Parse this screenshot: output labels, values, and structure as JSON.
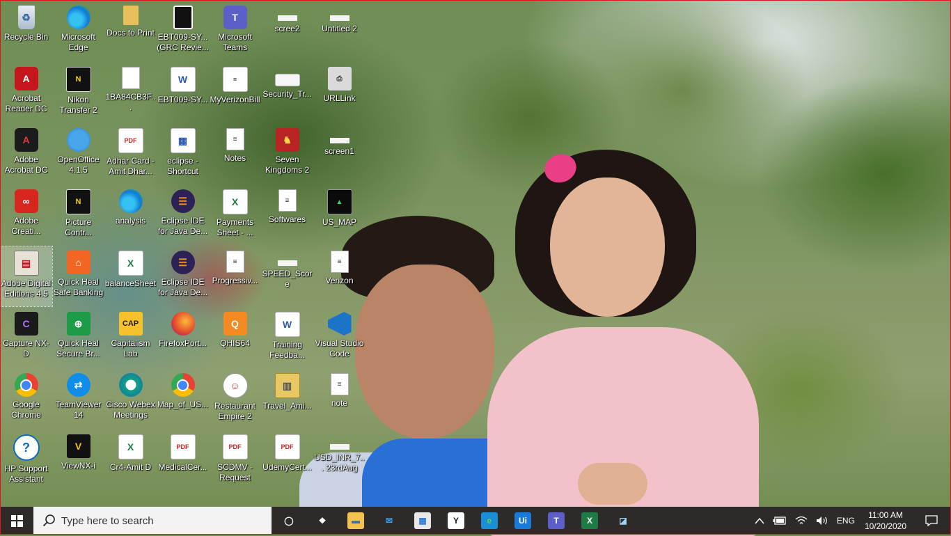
{
  "desktop": {
    "icons": [
      {
        "label": "Recycle Bin",
        "icon": "recycle-bin-icon",
        "glyph": "♻",
        "style": "ic-recycle",
        "col": 0,
        "row": 0
      },
      {
        "label": "Microsoft Edge",
        "icon": "edge-icon",
        "glyph": "",
        "style": "ic-edge",
        "col": 1,
        "row": 0
      },
      {
        "label": "Docs to Print",
        "icon": "folder-icon",
        "glyph": "",
        "style": "ic-folder",
        "col": 2,
        "row": 0
      },
      {
        "label": "EBT009-SY... (GRC Revie...",
        "icon": "document-icon",
        "glyph": "",
        "style": "ic-docblack",
        "col": 3,
        "row": 0
      },
      {
        "label": "Microsoft Teams",
        "icon": "teams-icon",
        "glyph": "T",
        "style": "ic-teams",
        "col": 4,
        "row": 0
      },
      {
        "label": "scree2",
        "icon": "image-file-icon",
        "glyph": "",
        "style": "ic-strip",
        "col": 5,
        "row": 0
      },
      {
        "label": "Untitled 2",
        "icon": "image-file-icon",
        "glyph": "",
        "style": "ic-strip",
        "col": 6,
        "row": 0
      },
      {
        "label": "Acrobat Reader DC",
        "icon": "acrobat-reader-icon",
        "glyph": "A",
        "style": "ic-acrobat",
        "col": 0,
        "row": 1
      },
      {
        "label": "Nikon Transfer 2",
        "icon": "nikon-transfer-icon",
        "glyph": "N",
        "style": "ic-nikon",
        "col": 1,
        "row": 1
      },
      {
        "label": "1BA84CB3F...",
        "icon": "blank-file-icon",
        "glyph": "",
        "style": "ic-doc",
        "col": 2,
        "row": 1
      },
      {
        "label": "EBT009-SY...",
        "icon": "word-doc-icon",
        "glyph": "W",
        "style": "ic-word",
        "col": 3,
        "row": 1
      },
      {
        "label": "MyVerizonBill",
        "icon": "bill-doc-icon",
        "glyph": "≡",
        "style": "ic-bill",
        "col": 4,
        "row": 1
      },
      {
        "label": "Security_Tr...",
        "icon": "image-file-icon",
        "glyph": "",
        "style": "ic-security",
        "col": 5,
        "row": 1
      },
      {
        "label": "URLLink",
        "icon": "url-link-icon",
        "glyph": "⎙",
        "style": "ic-url",
        "col": 6,
        "row": 1
      },
      {
        "label": "Adobe Acrobat DC",
        "icon": "acrobat-dc-icon",
        "glyph": "A",
        "style": "ic-acrobatdark",
        "col": 0,
        "row": 2
      },
      {
        "label": "OpenOffice 4.1.5",
        "icon": "openoffice-icon",
        "glyph": "",
        "style": "ic-oo",
        "col": 1,
        "row": 2
      },
      {
        "label": "Adhar Card - Amit Dhar...",
        "icon": "pdf-icon",
        "glyph": "PDF",
        "style": "ic-pdf",
        "col": 2,
        "row": 2
      },
      {
        "label": "eclipse - Shortcut",
        "icon": "eclipse-shortcut-icon",
        "glyph": "▦",
        "style": "ic-word",
        "col": 3,
        "row": 2
      },
      {
        "label": "Notes",
        "icon": "text-file-icon",
        "glyph": "≡",
        "style": "ic-doc",
        "col": 4,
        "row": 2
      },
      {
        "label": "Seven Kingdoms 2",
        "icon": "game-icon",
        "glyph": "♞",
        "style": "ic-game",
        "col": 5,
        "row": 2
      },
      {
        "label": "screen1",
        "icon": "image-file-icon",
        "glyph": "",
        "style": "ic-strip",
        "col": 6,
        "row": 2
      },
      {
        "label": "Adobe Creati...",
        "icon": "creative-cloud-icon",
        "glyph": "∞",
        "style": "ic-cc",
        "col": 0,
        "row": 3
      },
      {
        "label": "Picture Contr...",
        "icon": "picture-control-icon",
        "glyph": "N",
        "style": "ic-nikon",
        "col": 1,
        "row": 3
      },
      {
        "label": "analysis",
        "icon": "edge-icon",
        "glyph": "",
        "style": "ic-edge",
        "col": 2,
        "row": 3
      },
      {
        "label": "Eclipse IDE for Java De...",
        "icon": "eclipse-icon",
        "glyph": "☰",
        "style": "ic-eclipse",
        "col": 3,
        "row": 3
      },
      {
        "label": "Payments Sheet - ...",
        "icon": "excel-icon",
        "glyph": "X",
        "style": "ic-xl",
        "col": 4,
        "row": 3
      },
      {
        "label": "Softwares",
        "icon": "text-file-icon",
        "glyph": "≡",
        "style": "ic-doc",
        "col": 5,
        "row": 3
      },
      {
        "label": "US_MAP",
        "icon": "map-icon",
        "glyph": "▲",
        "style": "ic-map",
        "col": 6,
        "row": 3
      },
      {
        "label": "Adobe Digital Editions 4.5",
        "icon": "adobe-digital-editions-icon",
        "glyph": "▤",
        "style": "ic-ade",
        "col": 0,
        "row": 4,
        "selected": true
      },
      {
        "label": "Quick Heal Safe Banking",
        "icon": "quick-heal-banking-icon",
        "glyph": "⌂",
        "style": "ic-qh",
        "col": 1,
        "row": 4
      },
      {
        "label": "balanceSheet",
        "icon": "excel-icon",
        "glyph": "X",
        "style": "ic-xl",
        "col": 2,
        "row": 4
      },
      {
        "label": "Eclipse IDE for Java De...",
        "icon": "eclipse-icon",
        "glyph": "☰",
        "style": "ic-eclipse",
        "col": 3,
        "row": 4
      },
      {
        "label": "Progressiv...",
        "icon": "text-file-icon",
        "glyph": "≡",
        "style": "ic-doc",
        "col": 4,
        "row": 4
      },
      {
        "label": "SPEED_Score",
        "icon": "image-file-icon",
        "glyph": "",
        "style": "ic-strip",
        "col": 5,
        "row": 4
      },
      {
        "label": "Verizon",
        "icon": "text-file-icon",
        "glyph": "≡",
        "style": "ic-doc",
        "col": 6,
        "row": 4
      },
      {
        "label": "Capture NX-D",
        "icon": "capture-nxd-icon",
        "glyph": "C",
        "style": "ic-capture",
        "col": 0,
        "row": 5
      },
      {
        "label": "Quick Heal Secure Br...",
        "icon": "quick-heal-browser-icon",
        "glyph": "⊕",
        "style": "ic-qhs",
        "col": 1,
        "row": 5
      },
      {
        "label": "Capitalism Lab",
        "icon": "capitalism-lab-icon",
        "glyph": "CAP",
        "style": "ic-cap",
        "col": 2,
        "row": 5
      },
      {
        "label": "FirefoxPort...",
        "icon": "firefox-icon",
        "glyph": "",
        "style": "ic-ff",
        "col": 3,
        "row": 5
      },
      {
        "label": "QHIS64",
        "icon": "qhis-icon",
        "glyph": "Q",
        "style": "ic-qhis",
        "col": 4,
        "row": 5
      },
      {
        "label": "Training Feedba...",
        "icon": "word-doc-icon",
        "glyph": "W",
        "style": "ic-word",
        "col": 5,
        "row": 5
      },
      {
        "label": "Visual Studio Code",
        "icon": "vscode-icon",
        "glyph": "",
        "style": "ic-vs",
        "col": 6,
        "row": 5
      },
      {
        "label": "Google Chrome",
        "icon": "chrome-icon",
        "glyph": "",
        "style": "ic-chrome",
        "col": 0,
        "row": 6
      },
      {
        "label": "TeamViewer 14",
        "icon": "teamviewer-icon",
        "glyph": "⇄",
        "style": "ic-tv",
        "col": 1,
        "row": 6
      },
      {
        "label": "Cisco Webex Meetings",
        "icon": "webex-icon",
        "glyph": "",
        "style": "ic-webex",
        "col": 2,
        "row": 6
      },
      {
        "label": "Map_of_US...",
        "icon": "chrome-icon",
        "glyph": "",
        "style": "ic-chrome",
        "col": 3,
        "row": 6
      },
      {
        "label": "Restaurant Empire 2",
        "icon": "chef-icon",
        "glyph": "☺",
        "style": "ic-chef",
        "col": 4,
        "row": 6
      },
      {
        "label": "Travel_Ami...",
        "icon": "zip-folder-icon",
        "glyph": "▥",
        "style": "ic-zip",
        "col": 5,
        "row": 6
      },
      {
        "label": "note",
        "icon": "text-file-icon",
        "glyph": "≡",
        "style": "ic-doc",
        "col": 6,
        "row": 6
      },
      {
        "label": "HP Support Assistant",
        "icon": "hp-support-icon",
        "glyph": "?",
        "style": "ic-hp",
        "col": 0,
        "row": 7
      },
      {
        "label": "ViewNX-i",
        "icon": "viewnx-icon",
        "glyph": "V",
        "style": "ic-viewnx",
        "col": 1,
        "row": 7
      },
      {
        "label": "Cr4-Amit D",
        "icon": "excel-icon",
        "glyph": "X",
        "style": "ic-xl",
        "col": 2,
        "row": 7
      },
      {
        "label": "MedicalCer...",
        "icon": "pdf-icon",
        "glyph": "PDF",
        "style": "ic-pdf",
        "col": 3,
        "row": 7
      },
      {
        "label": "SCDMV - Request",
        "icon": "pdf-icon",
        "glyph": "PDF",
        "style": "ic-pdf",
        "col": 4,
        "row": 7
      },
      {
        "label": "UdemyCert...",
        "icon": "pdf-icon",
        "glyph": "PDF",
        "style": "ic-pdf",
        "col": 5,
        "row": 7
      },
      {
        "label": "USD_INR_7... 23rdAug",
        "icon": "image-file-icon",
        "glyph": "",
        "style": "ic-strip",
        "col": 6,
        "row": 7
      }
    ]
  },
  "taskbar": {
    "search_placeholder": "Type here to search",
    "pinned": [
      {
        "name": "task-view-icon",
        "glyph": "◯",
        "bg": "transparent",
        "color": "#ffffff"
      },
      {
        "name": "dropbox-icon",
        "glyph": "❖",
        "bg": "transparent",
        "color": "#ffffff"
      },
      {
        "name": "file-explorer-icon",
        "glyph": "▬",
        "bg": "#f2c14e",
        "color": "#2f6fb3"
      },
      {
        "name": "mail-icon",
        "glyph": "✉",
        "bg": "transparent",
        "color": "#3aa0f0"
      },
      {
        "name": "store-icon",
        "glyph": "▦",
        "bg": "#e8e8e8",
        "color": "#2d7dd2"
      },
      {
        "name": "sticky-app-icon",
        "glyph": "Y",
        "bg": "#ffffff",
        "color": "#1b1b1b"
      },
      {
        "name": "edge-icon",
        "glyph": "e",
        "bg": "#1a8fd6",
        "color": "#5bd36a"
      },
      {
        "name": "uipath-icon",
        "glyph": "Ui",
        "bg": "#1a7ad8",
        "color": "#ffffff"
      },
      {
        "name": "teams-icon",
        "glyph": "T",
        "bg": "#5b5fc7",
        "color": "#ffffff"
      },
      {
        "name": "excel-icon",
        "glyph": "X",
        "bg": "#1e7b45",
        "color": "#ffffff"
      },
      {
        "name": "snipping-tool-icon",
        "glyph": "◪",
        "bg": "transparent",
        "color": "#9fd3f5"
      }
    ],
    "tray": {
      "language": "ENG",
      "time": "11:00 AM",
      "date": "10/20/2020"
    }
  }
}
